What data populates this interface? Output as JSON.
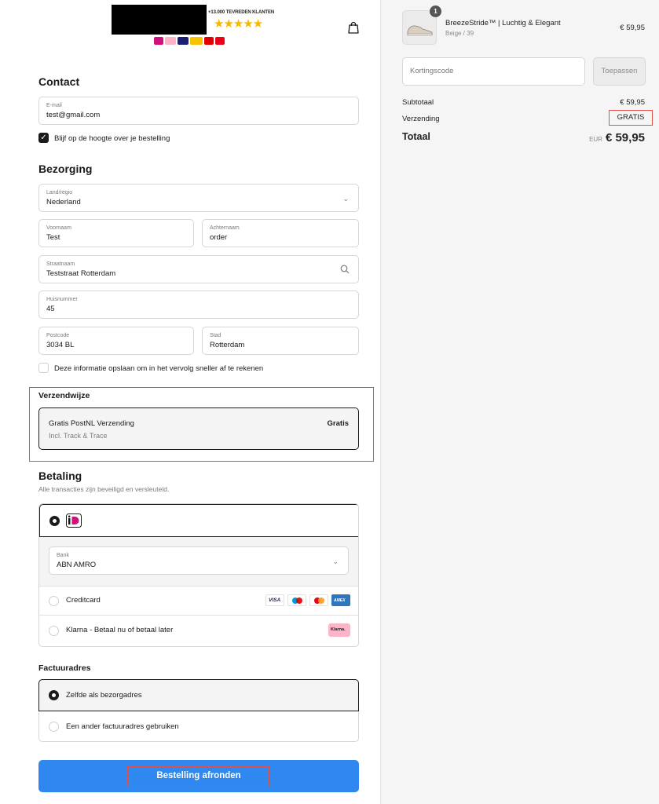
{
  "header": {
    "trust_text": "+13.000 TEVREDEN KLANTEN",
    "stars": "★★★★★",
    "star_color": "#f5b900",
    "logo_redacted": true,
    "bag_icon": "shopping-bag-icon"
  },
  "contact": {
    "heading": "Contact",
    "email_label": "E-mail",
    "email_value": "test@gmail.com",
    "newsletter_checked": true,
    "newsletter_label": "Blijf op de hoogte over je bestelling"
  },
  "delivery": {
    "heading": "Bezorging",
    "country_label": "Land/regio",
    "country_value": "Nederland",
    "first_name_label": "Voornaam",
    "first_name_value": "Test",
    "last_name_label": "Achternaam",
    "last_name_value": "order",
    "street_label": "Straatnaam",
    "street_value": "Teststraat Rotterdam",
    "house_label": "Huisnummer",
    "house_value": "45",
    "postcode_label": "Postcode",
    "postcode_value": "3034 BL",
    "city_label": "Stad",
    "city_value": "Rotterdam",
    "save_checked": false,
    "save_label": "Deze informatie opslaan om in het vervolg sneller af te rekenen"
  },
  "shipping": {
    "heading": "Verzendwijze",
    "method": "Gratis PostNL Verzending",
    "method_sub": "Incl. Track & Trace",
    "price": "Gratis"
  },
  "payment": {
    "heading": "Betaling",
    "subtitle": "Alle transacties zijn beveiligd en versleuteld.",
    "selected_method": "iDEAL",
    "bank_label": "Bank",
    "bank_value": "ABN AMRO",
    "creditcard_label": "Creditcard",
    "creditcard_brands": [
      "VISA",
      "Maestro",
      "Mastercard",
      "AMEX"
    ],
    "klarna_label": "Klarna - Betaal nu of betaal later",
    "klarna_badge": "Klarna."
  },
  "billing": {
    "heading": "Factuuradres",
    "option_same": "Zelfde als bezorgadres",
    "option_other": "Een ander factuuradres gebruiken",
    "selected": "same"
  },
  "submit": {
    "label": "Bestelling afronden",
    "color": "#2f87f0"
  },
  "summary": {
    "product_name": "BreezeStride™ | Luchtig & Elegant",
    "product_variant": "Beige / 39",
    "product_price": "€ 59,95",
    "quantity": "1",
    "discount_placeholder": "Kortingscode",
    "apply_label": "Toepassen",
    "subtotal_label": "Subtotaal",
    "subtotal_value": "€ 59,95",
    "shipping_label": "Verzending",
    "shipping_value": "GRATIS",
    "total_label": "Totaal",
    "total_currency": "EUR",
    "total_value": "€ 59,95"
  },
  "highlight_color": "#e0514a"
}
